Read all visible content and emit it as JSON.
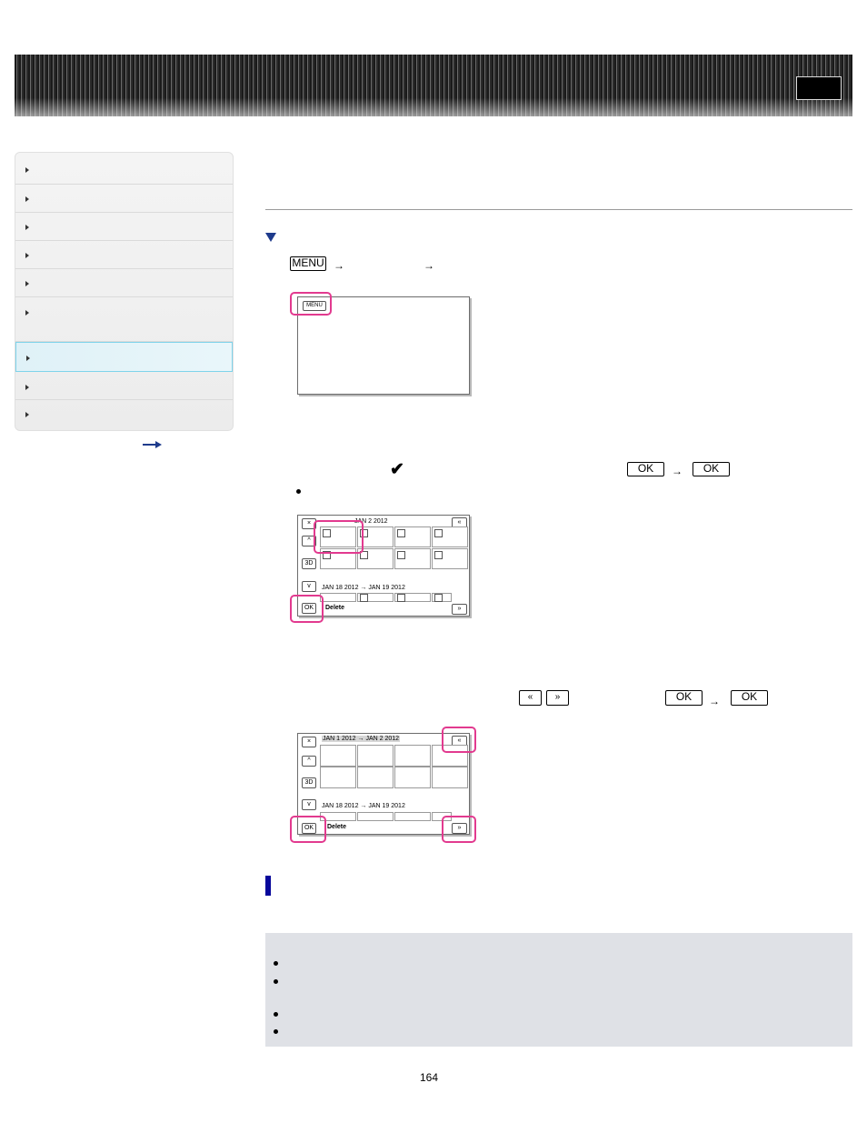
{
  "header": {
    "title": ""
  },
  "sidebar": {
    "items": [
      {
        "label": ""
      },
      {
        "label": ""
      },
      {
        "label": ""
      },
      {
        "label": ""
      },
      {
        "label": ""
      },
      {
        "label": ""
      },
      {
        "label": ""
      },
      {
        "label": ""
      },
      {
        "label": ""
      }
    ],
    "active_index": 6
  },
  "step1": {
    "menu_key": "MENU",
    "arrow": "→"
  },
  "screen1": {
    "menu_button": "MENU"
  },
  "step2": {
    "check_mark": "✔",
    "ok1": "OK",
    "ok2": "OK",
    "arrow": "→"
  },
  "screen2": {
    "close": "×",
    "up": "^",
    "mode": "3D",
    "down": "v",
    "ok": "OK",
    "page_up": "«",
    "page_down": "»",
    "range1": "JAN 1 2012 → JAN 2 2012",
    "range1_partial": "JAN 2 2012",
    "range2": "JAN 18 2012 → JAN 19 2012",
    "action": "Delete"
  },
  "step3": {
    "page_up": "«",
    "page_down": "»",
    "ok1": "OK",
    "ok2": "OK",
    "arrow": "→"
  },
  "screen3": {
    "close": "×",
    "up": "^",
    "mode": "3D",
    "down": "v",
    "ok": "OK",
    "page_up": "«",
    "page_down": "»",
    "range1": "JAN 1 2012 → JAN 2 2012",
    "range2": "JAN 18 2012 → JAN 19 2012",
    "action": "Delete"
  },
  "footer": {
    "page_number": "164"
  },
  "colors": {
    "highlight": "#e23a8f",
    "accent_blue": "#07079b",
    "note_bg": "#dfe1e6"
  }
}
